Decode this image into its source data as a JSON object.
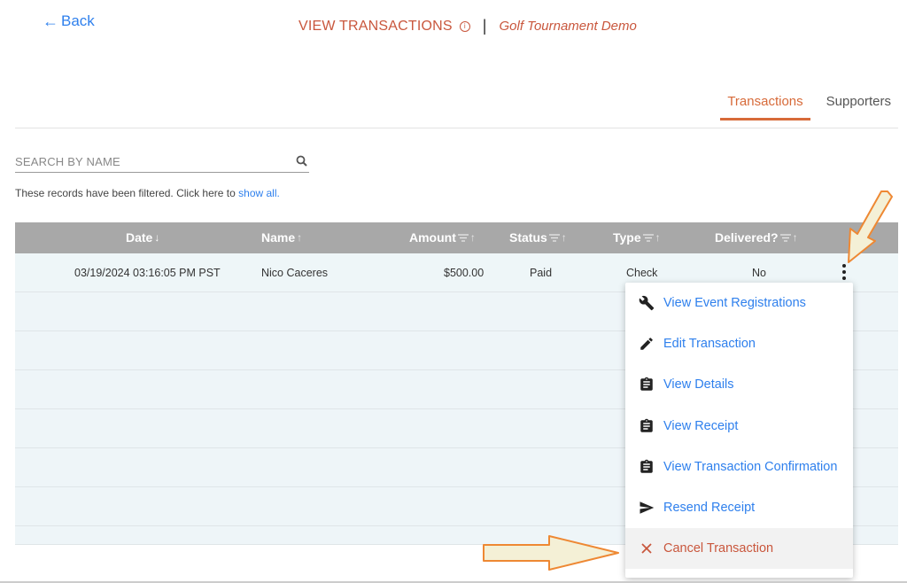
{
  "nav": {
    "back_label": "Back"
  },
  "header": {
    "title": "VIEW TRANSACTIONS",
    "subtitle": "Golf Tournament Demo"
  },
  "tabs": [
    {
      "label": "Transactions",
      "active": true
    },
    {
      "label": "Supporters",
      "active": false
    }
  ],
  "search": {
    "placeholder": "SEARCH BY NAME"
  },
  "filter_notice": {
    "text": "These records have been filtered. Click here to ",
    "link": "show all."
  },
  "table": {
    "columns": [
      "Date",
      "Name",
      "Amount",
      "Status",
      "Type",
      "Delivered?"
    ],
    "rows": [
      {
        "date": "03/19/2024 03:16:05 PM PST",
        "name": "Nico Caceres",
        "amount": "$500.00",
        "status": "Paid",
        "type": "Check",
        "delivered": "No"
      }
    ]
  },
  "menu": {
    "items": [
      {
        "label": "View Event Registrations",
        "icon": "wrench-icon"
      },
      {
        "label": "Edit Transaction",
        "icon": "pencil-icon"
      },
      {
        "label": "View Details",
        "icon": "clipboard-icon"
      },
      {
        "label": "View Receipt",
        "icon": "clipboard-icon"
      },
      {
        "label": "View Transaction Confirmation",
        "icon": "clipboard-icon"
      },
      {
        "label": "Resend Receipt",
        "icon": "send-icon"
      },
      {
        "label": "Cancel Transaction",
        "icon": "close-icon"
      }
    ]
  },
  "colors": {
    "accent": "#c9573d",
    "link": "#2f80ed",
    "header_bg": "#a8a8a8",
    "row_bg": "#eef5f8"
  }
}
